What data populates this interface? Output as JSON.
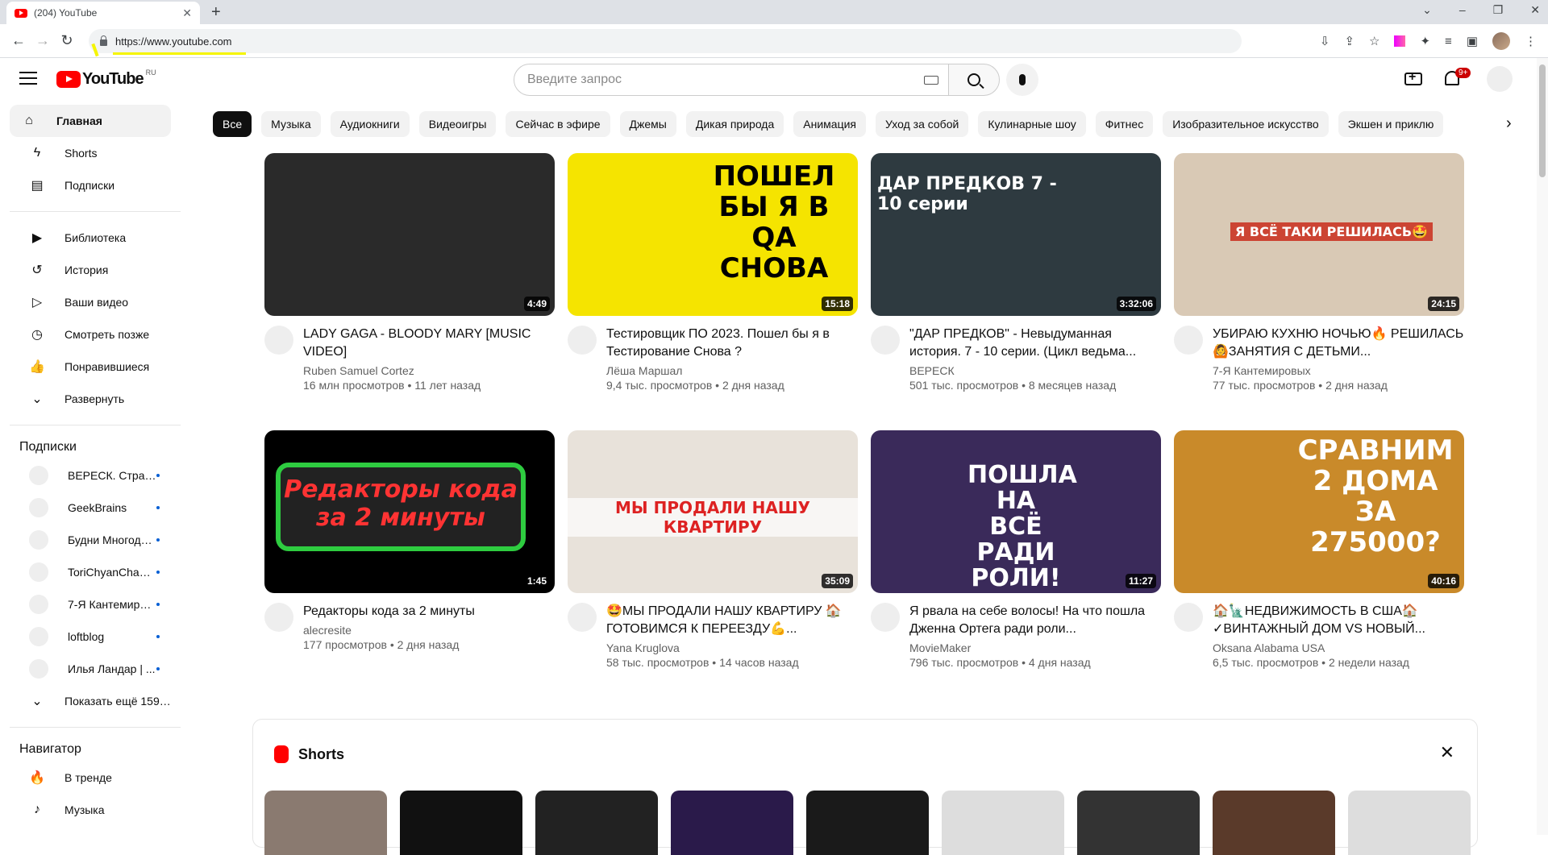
{
  "browser": {
    "tab_title": "(204) YouTube",
    "url": "https://www.youtube.com"
  },
  "header": {
    "logo_text": "YouTube",
    "region": "RU",
    "search_placeholder": "Введите запрос",
    "notifications_badge": "9+"
  },
  "sidebar": {
    "main": [
      {
        "label": "Главная",
        "icon": "home-icon"
      },
      {
        "label": "Shorts",
        "icon": "shorts-icon"
      },
      {
        "label": "Подписки",
        "icon": "subscriptions-icon"
      }
    ],
    "library": [
      {
        "label": "Библиотека",
        "icon": "library-icon"
      },
      {
        "label": "История",
        "icon": "history-icon"
      },
      {
        "label": "Ваши видео",
        "icon": "your-videos-icon"
      },
      {
        "label": "Смотреть позже",
        "icon": "watch-later-icon"
      },
      {
        "label": "Понравившиеся",
        "icon": "liked-icon"
      },
      {
        "label": "Развернуть",
        "icon": "chevron-down-icon"
      }
    ],
    "subscriptions_title": "Подписки",
    "subscriptions": [
      {
        "label": "ВЕРЕСК. Страш..."
      },
      {
        "label": "GeekBrains"
      },
      {
        "label": "Будни Многоде..."
      },
      {
        "label": "ToriChyanChannel"
      },
      {
        "label": "7-Я Кантемиров..."
      },
      {
        "label": "loftblog"
      },
      {
        "label": "Илья Ландар | ..."
      }
    ],
    "show_more": "Показать ещё 159 ...",
    "navigator_title": "Навигатор",
    "navigator": [
      {
        "label": "В тренде",
        "icon": "trending-icon"
      },
      {
        "label": "Музыка",
        "icon": "music-icon"
      }
    ]
  },
  "chips": [
    "Все",
    "Музыка",
    "Аудиокниги",
    "Видеоигры",
    "Сейчас в эфире",
    "Джемы",
    "Дикая природа",
    "Анимация",
    "Уход за собой",
    "Кулинарные шоу",
    "Фитнес",
    "Изобразительное искусство",
    "Экшен и приклю"
  ],
  "videos": [
    {
      "title": "LADY GAGA - BLOODY MARY [MUSIC VIDEO]",
      "channel": "Ruben Samuel Cortez",
      "stats": "16 млн просмотров • 11 лет назад",
      "duration": "4:49",
      "thumb_bg": "#2a2a2a",
      "thumb_text": ""
    },
    {
      "title": "Тестировщик ПО 2023. Пошел бы я в Тестирование Снова ?",
      "channel": "Лёша Маршал",
      "stats": "9,4 тыс. просмотров • 2 дня назад",
      "duration": "15:18",
      "thumb_bg": "#f5e400",
      "thumb_text": "ПОШЕЛ БЫ Я В QA СНОВА"
    },
    {
      "title": "\"ДАР ПРЕДКОВ\" - Невыдуманная история. 7 - 10 серии. (Цикл ведьма...",
      "channel": "ВЕРЕСК",
      "stats": "501 тыс. просмотров • 8 месяцев назад",
      "duration": "3:32:06",
      "thumb_bg": "#2e3a40",
      "thumb_text": "ДАР ПРЕДКОВ 7 - 10 серии"
    },
    {
      "title": "УБИРАЮ КУХНЮ НОЧЬЮ🔥 РЕШИЛАСЬ🙆ЗАНЯТИЯ С ДЕТЬМИ...",
      "channel": "7-Я Кантемировых",
      "stats": "77 тыс. просмотров • 2 дня назад",
      "duration": "24:15",
      "thumb_bg": "#d9c9b5",
      "thumb_text": "Я ВСЁ ТАКИ РЕШИЛАСЬ🤩"
    },
    {
      "title": "Редакторы кода за 2 минуты",
      "channel": "alecresite",
      "stats": "177 просмотров • 2 дня назад",
      "duration": "1:45",
      "thumb_bg": "#000000",
      "thumb_text": "Редакторы кода за 2 минуты"
    },
    {
      "title": "🤩МЫ ПРОДАЛИ НАШУ КВАРТИРУ 🏠ГОТОВИМСЯ К ПЕРЕЕЗДУ💪...",
      "channel": "Yana Kruglova",
      "stats": "58 тыс. просмотров • 14 часов назад",
      "duration": "35:09",
      "thumb_bg": "#e8e2da",
      "thumb_text": "МЫ ПРОДАЛИ НАШУ КВАРТИРУ"
    },
    {
      "title": "Я рвала на себе волосы! На что пошла Дженна Ортега ради роли...",
      "channel": "MovieMaker",
      "stats": "796 тыс. просмотров • 4 дня назад",
      "duration": "11:27",
      "thumb_bg": "#3a2a5a",
      "thumb_text": "ПОШЛА НА ВСЁ РАДИ РОЛИ!"
    },
    {
      "title": "🏠🗽НЕДВИЖИМОСТЬ В США🏠 ✓ВИНТАЖНЫЙ ДОМ VS НОВЫЙ...",
      "channel": "Oksana Alabama USA",
      "stats": "6,5 тыс. просмотров • 2 недели назад",
      "duration": "40:16",
      "thumb_bg": "#c98a2a",
      "thumb_text": "СРАВНИМ 2 ДОМА ЗА 275000?"
    }
  ],
  "shorts": {
    "title": "Shorts",
    "colors": [
      "#8a7a70",
      "#111111",
      "#222222",
      "#2a1a4a",
      "#1a1a1a",
      "#dddddd",
      "#333333",
      "#5a3a2a",
      "#dddddd"
    ]
  }
}
